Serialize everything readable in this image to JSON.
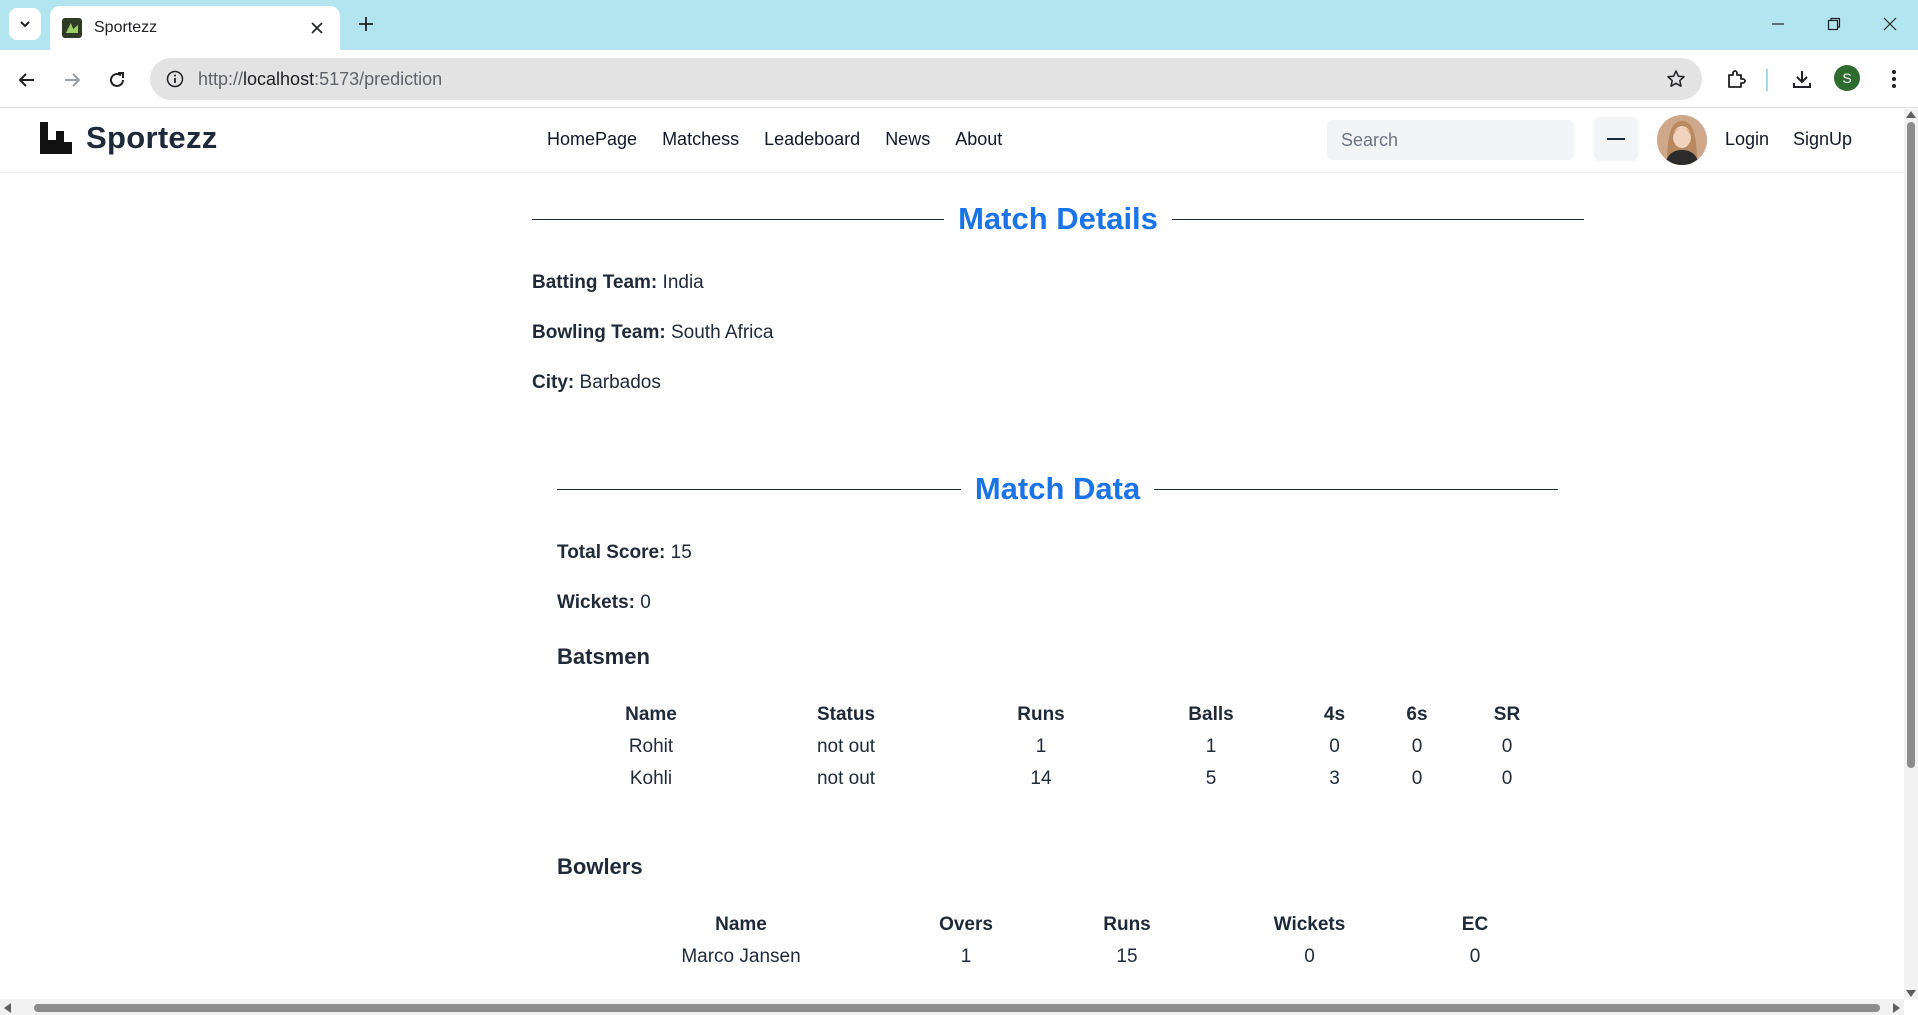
{
  "browser": {
    "tab_title": "Sportezz",
    "url_prefix": "http://",
    "url_host": "localhost",
    "url_path": ":5173/prediction",
    "profile_initial": "S"
  },
  "header": {
    "brand": "Sportezz",
    "nav": [
      "HomePage",
      "Matchess",
      "Leadeboard",
      "News",
      "About"
    ],
    "search_placeholder": "Search",
    "login": "Login",
    "signup": "SignUp"
  },
  "match_details": {
    "title": "Match Details",
    "batting_label": "Batting Team:",
    "batting_value": "India",
    "bowling_label": "Bowling Team:",
    "bowling_value": "South Africa",
    "city_label": "City:",
    "city_value": "Barbados"
  },
  "match_data": {
    "title": "Match Data",
    "total_label": "Total Score:",
    "total_value": "15",
    "wickets_label": "Wickets:",
    "wickets_value": "0",
    "batsmen_heading": "Batsmen",
    "batsmen_columns": [
      "Name",
      "Status",
      "Runs",
      "Balls",
      "4s",
      "6s",
      "SR"
    ],
    "batsmen": [
      [
        "Rohit",
        "not out",
        "1",
        "1",
        "0",
        "0",
        "0"
      ],
      [
        "Kohli",
        "not out",
        "14",
        "5",
        "3",
        "0",
        "0"
      ]
    ],
    "bowlers_heading": "Bowlers",
    "bowlers_columns": [
      "Name",
      "Overs",
      "Runs",
      "Wickets",
      "EC"
    ],
    "bowlers": [
      [
        "Marco Jansen",
        "1",
        "15",
        "0",
        "0"
      ]
    ]
  },
  "colors": {
    "tabstrip": "#b3e5f0",
    "accent_title": "#1a73e8",
    "profile": "#2e6b2e"
  }
}
